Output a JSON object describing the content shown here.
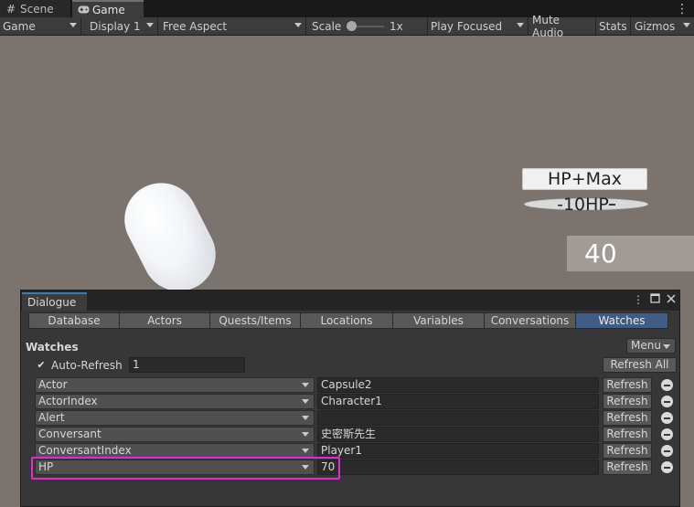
{
  "editor": {
    "tabs": [
      {
        "label": "Scene",
        "icon": "scene-grid-icon"
      },
      {
        "label": "Game",
        "icon": "gamepad-icon"
      }
    ],
    "menu_icon": "vertical-dots-icon"
  },
  "game_toolbar": {
    "mode": "Game",
    "display": "Display 1",
    "aspect": "Free Aspect",
    "scale_label": "Scale",
    "scale_value": "1x",
    "play_mode": "Play Focused",
    "mute": "Mute Audio",
    "stats": "Stats",
    "gizmos": "Gizmos"
  },
  "game_view": {
    "btn_max": "HP+Max",
    "btn_minus": "-10HP",
    "hp_value": "40"
  },
  "dialogue": {
    "window_title": "Dialogue",
    "tabs": [
      {
        "label": "Database",
        "active": false
      },
      {
        "label": "Actors",
        "active": false
      },
      {
        "label": "Quests/Items",
        "active": false
      },
      {
        "label": "Locations",
        "active": false
      },
      {
        "label": "Variables",
        "active": false
      },
      {
        "label": "Conversations",
        "active": false
      },
      {
        "label": "Watches",
        "active": true
      }
    ],
    "section_title": "Watches",
    "menu_label": "Menu",
    "auto_refresh_label": "Auto-Refresh",
    "auto_refresh_checked": true,
    "auto_refresh_value": "1",
    "refresh_all_label": "Refresh All",
    "refresh_label": "Refresh",
    "watches": [
      {
        "name": "Actor",
        "value": "Capsule2"
      },
      {
        "name": "ActorIndex",
        "value": "Character1"
      },
      {
        "name": "Alert",
        "value": ""
      },
      {
        "name": "Conversant",
        "value": "史密斯先生"
      },
      {
        "name": "ConversantIndex",
        "value": "Player1"
      },
      {
        "name": "HP",
        "value": "70"
      }
    ],
    "highlight_color": "#e02ad8",
    "active_tab_color": "#3f5c86"
  }
}
